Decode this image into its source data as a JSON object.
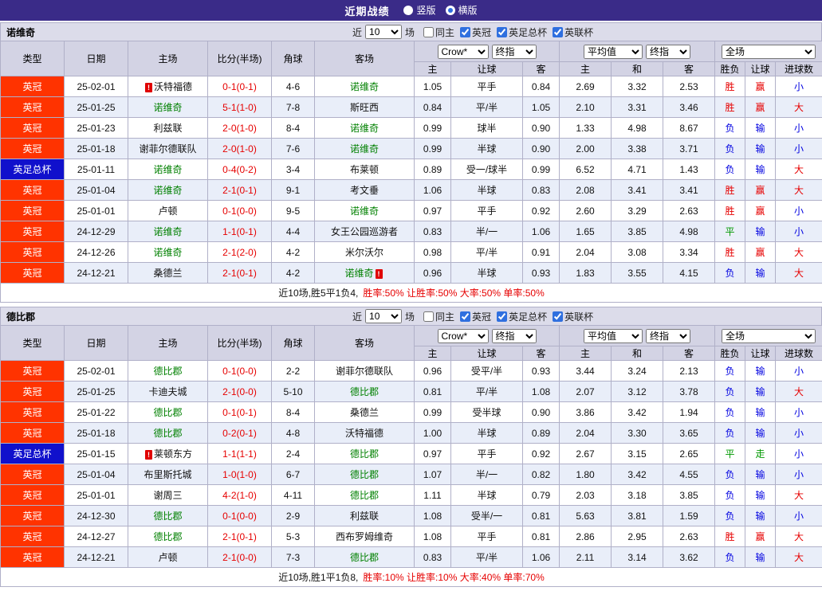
{
  "topbar": {
    "title": "近期战绩",
    "options": [
      {
        "label": "竖版",
        "selected": false
      },
      {
        "label": "横版",
        "selected": true
      }
    ]
  },
  "controls": {
    "near_label": "近",
    "match_count": "10",
    "unit_label": "场",
    "filters": [
      {
        "label": "同主",
        "checked": false
      },
      {
        "label": "英冠",
        "checked": true
      },
      {
        "label": "英足总杯",
        "checked": true
      },
      {
        "label": "英联杯",
        "checked": true
      }
    ]
  },
  "table": {
    "headers": {
      "type": "类型",
      "date": "日期",
      "home": "主场",
      "score": "比分(半场)",
      "corners": "角球",
      "away": "客场",
      "odds_sub": [
        "主",
        "让球",
        "客"
      ],
      "avg_sub": [
        "主",
        "和",
        "客"
      ],
      "result_sub": [
        "胜负",
        "让球",
        "进球数"
      ]
    },
    "selects": {
      "company": "Crow*",
      "final_a": "终指",
      "average": "平均值",
      "final_b": "终指",
      "full": "全场"
    }
  },
  "colors": {
    "topbar_bg": "#3a2b88",
    "control_bg": "#dcdcea",
    "header_bg": "#d3d3e4",
    "border": "#b0b0c8",
    "alt_row_bg": "#e9eef9",
    "league_bg": "#ff3300",
    "cup_bg": "#1010cc",
    "featured_team": "#008000",
    "score": "#e60000",
    "result_win": "#e60000",
    "result_loss": "#0000e0",
    "result_draw": "#009900",
    "rate_text": "#e60000",
    "radio_dot": "#2f6fdf"
  },
  "result_color_map": {
    "胜": "win",
    "赢": "win",
    "大": "win",
    "负": "loss",
    "输": "loss",
    "小": "loss",
    "平": "draw",
    "走": "draw"
  },
  "sections": [
    {
      "team": "诺维奇",
      "summary_prefix": "近10场,胜5平1负4,",
      "summary_rates": "胜率:50% 让胜率:50% 大率:50% 单率:50%",
      "rows": [
        {
          "type": "英冠",
          "cup": false,
          "date": "25-02-01",
          "home": "沃特福德",
          "home_featured": false,
          "home_alert": "before",
          "score": "0-1(0-1)",
          "corners": "4-6",
          "away": "诺维奇",
          "away_featured": true,
          "away_alert": "none",
          "odds": [
            "1.05",
            "平手",
            "0.84"
          ],
          "avg": [
            "2.69",
            "3.32",
            "2.53"
          ],
          "results": [
            "胜",
            "赢",
            "小"
          ]
        },
        {
          "type": "英冠",
          "cup": false,
          "date": "25-01-25",
          "home": "诺维奇",
          "home_featured": true,
          "home_alert": "none",
          "score": "5-1(1-0)",
          "corners": "7-8",
          "away": "斯旺西",
          "away_featured": false,
          "away_alert": "none",
          "odds": [
            "0.84",
            "平/半",
            "1.05"
          ],
          "avg": [
            "2.10",
            "3.31",
            "3.46"
          ],
          "results": [
            "胜",
            "赢",
            "大"
          ]
        },
        {
          "type": "英冠",
          "cup": false,
          "date": "25-01-23",
          "home": "利兹联",
          "home_featured": false,
          "home_alert": "none",
          "score": "2-0(1-0)",
          "corners": "8-4",
          "away": "诺维奇",
          "away_featured": true,
          "away_alert": "none",
          "odds": [
            "0.99",
            "球半",
            "0.90"
          ],
          "avg": [
            "1.33",
            "4.98",
            "8.67"
          ],
          "results": [
            "负",
            "输",
            "小"
          ]
        },
        {
          "type": "英冠",
          "cup": false,
          "date": "25-01-18",
          "home": "谢菲尔德联队",
          "home_featured": false,
          "home_alert": "none",
          "score": "2-0(1-0)",
          "corners": "7-6",
          "away": "诺维奇",
          "away_featured": true,
          "away_alert": "none",
          "odds": [
            "0.99",
            "半球",
            "0.90"
          ],
          "avg": [
            "2.00",
            "3.38",
            "3.71"
          ],
          "results": [
            "负",
            "输",
            "小"
          ]
        },
        {
          "type": "英足总杯",
          "cup": true,
          "date": "25-01-11",
          "home": "诺维奇",
          "home_featured": true,
          "home_alert": "none",
          "score": "0-4(0-2)",
          "corners": "3-4",
          "away": "布莱顿",
          "away_featured": false,
          "away_alert": "none",
          "odds": [
            "0.89",
            "受一/球半",
            "0.99"
          ],
          "avg": [
            "6.52",
            "4.71",
            "1.43"
          ],
          "results": [
            "负",
            "输",
            "大"
          ]
        },
        {
          "type": "英冠",
          "cup": false,
          "date": "25-01-04",
          "home": "诺维奇",
          "home_featured": true,
          "home_alert": "none",
          "score": "2-1(0-1)",
          "corners": "9-1",
          "away": "考文垂",
          "away_featured": false,
          "away_alert": "none",
          "odds": [
            "1.06",
            "半球",
            "0.83"
          ],
          "avg": [
            "2.08",
            "3.41",
            "3.41"
          ],
          "results": [
            "胜",
            "赢",
            "大"
          ]
        },
        {
          "type": "英冠",
          "cup": false,
          "date": "25-01-01",
          "home": "卢顿",
          "home_featured": false,
          "home_alert": "none",
          "score": "0-1(0-0)",
          "corners": "9-5",
          "away": "诺维奇",
          "away_featured": true,
          "away_alert": "none",
          "odds": [
            "0.97",
            "平手",
            "0.92"
          ],
          "avg": [
            "2.60",
            "3.29",
            "2.63"
          ],
          "results": [
            "胜",
            "赢",
            "小"
          ]
        },
        {
          "type": "英冠",
          "cup": false,
          "date": "24-12-29",
          "home": "诺维奇",
          "home_featured": true,
          "home_alert": "none",
          "score": "1-1(0-1)",
          "corners": "4-4",
          "away": "女王公园巡游者",
          "away_featured": false,
          "away_alert": "none",
          "odds": [
            "0.83",
            "半/一",
            "1.06"
          ],
          "avg": [
            "1.65",
            "3.85",
            "4.98"
          ],
          "results": [
            "平",
            "输",
            "小"
          ]
        },
        {
          "type": "英冠",
          "cup": false,
          "date": "24-12-26",
          "home": "诺维奇",
          "home_featured": true,
          "home_alert": "none",
          "score": "2-1(2-0)",
          "corners": "4-2",
          "away": "米尔沃尔",
          "away_featured": false,
          "away_alert": "none",
          "odds": [
            "0.98",
            "平/半",
            "0.91"
          ],
          "avg": [
            "2.04",
            "3.08",
            "3.34"
          ],
          "results": [
            "胜",
            "赢",
            "大"
          ]
        },
        {
          "type": "英冠",
          "cup": false,
          "date": "24-12-21",
          "home": "桑德兰",
          "home_featured": false,
          "home_alert": "none",
          "score": "2-1(0-1)",
          "corners": "4-2",
          "away": "诺维奇",
          "away_featured": true,
          "away_alert": "after",
          "odds": [
            "0.96",
            "半球",
            "0.93"
          ],
          "avg": [
            "1.83",
            "3.55",
            "4.15"
          ],
          "results": [
            "负",
            "输",
            "大"
          ]
        }
      ]
    },
    {
      "team": "德比郡",
      "summary_prefix": "近10场,胜1平1负8,",
      "summary_rates": "胜率:10% 让胜率:10% 大率:40% 单率:70%",
      "rows": [
        {
          "type": "英冠",
          "cup": false,
          "date": "25-02-01",
          "home": "德比郡",
          "home_featured": true,
          "home_alert": "none",
          "score": "0-1(0-0)",
          "corners": "2-2",
          "away": "谢菲尔德联队",
          "away_featured": false,
          "away_alert": "none",
          "odds": [
            "0.96",
            "受平/半",
            "0.93"
          ],
          "avg": [
            "3.44",
            "3.24",
            "2.13"
          ],
          "results": [
            "负",
            "输",
            "小"
          ]
        },
        {
          "type": "英冠",
          "cup": false,
          "date": "25-01-25",
          "home": "卡迪夫城",
          "home_featured": false,
          "home_alert": "none",
          "score": "2-1(0-0)",
          "corners": "5-10",
          "away": "德比郡",
          "away_featured": true,
          "away_alert": "none",
          "odds": [
            "0.81",
            "平/半",
            "1.08"
          ],
          "avg": [
            "2.07",
            "3.12",
            "3.78"
          ],
          "results": [
            "负",
            "输",
            "大"
          ]
        },
        {
          "type": "英冠",
          "cup": false,
          "date": "25-01-22",
          "home": "德比郡",
          "home_featured": true,
          "home_alert": "none",
          "score": "0-1(0-1)",
          "corners": "8-4",
          "away": "桑德兰",
          "away_featured": false,
          "away_alert": "none",
          "odds": [
            "0.99",
            "受半球",
            "0.90"
          ],
          "avg": [
            "3.86",
            "3.42",
            "1.94"
          ],
          "results": [
            "负",
            "输",
            "小"
          ]
        },
        {
          "type": "英冠",
          "cup": false,
          "date": "25-01-18",
          "home": "德比郡",
          "home_featured": true,
          "home_alert": "none",
          "score": "0-2(0-1)",
          "corners": "4-8",
          "away": "沃特福德",
          "away_featured": false,
          "away_alert": "none",
          "odds": [
            "1.00",
            "半球",
            "0.89"
          ],
          "avg": [
            "2.04",
            "3.30",
            "3.65"
          ],
          "results": [
            "负",
            "输",
            "小"
          ]
        },
        {
          "type": "英足总杯",
          "cup": true,
          "date": "25-01-15",
          "home": "莱顿东方",
          "home_featured": false,
          "home_alert": "before",
          "score": "1-1(1-1)",
          "corners": "2-4",
          "away": "德比郡",
          "away_featured": true,
          "away_alert": "none",
          "odds": [
            "0.97",
            "平手",
            "0.92"
          ],
          "avg": [
            "2.67",
            "3.15",
            "2.65"
          ],
          "results": [
            "平",
            "走",
            "小"
          ]
        },
        {
          "type": "英冠",
          "cup": false,
          "date": "25-01-04",
          "home": "布里斯托城",
          "home_featured": false,
          "home_alert": "none",
          "score": "1-0(1-0)",
          "corners": "6-7",
          "away": "德比郡",
          "away_featured": true,
          "away_alert": "none",
          "odds": [
            "1.07",
            "半/一",
            "0.82"
          ],
          "avg": [
            "1.80",
            "3.42",
            "4.55"
          ],
          "results": [
            "负",
            "输",
            "小"
          ]
        },
        {
          "type": "英冠",
          "cup": false,
          "date": "25-01-01",
          "home": "谢周三",
          "home_featured": false,
          "home_alert": "none",
          "score": "4-2(1-0)",
          "corners": "4-11",
          "away": "德比郡",
          "away_featured": true,
          "away_alert": "none",
          "odds": [
            "1.11",
            "半球",
            "0.79"
          ],
          "avg": [
            "2.03",
            "3.18",
            "3.85"
          ],
          "results": [
            "负",
            "输",
            "大"
          ]
        },
        {
          "type": "英冠",
          "cup": false,
          "date": "24-12-30",
          "home": "德比郡",
          "home_featured": true,
          "home_alert": "none",
          "score": "0-1(0-0)",
          "corners": "2-9",
          "away": "利兹联",
          "away_featured": false,
          "away_alert": "none",
          "odds": [
            "1.08",
            "受半/一",
            "0.81"
          ],
          "avg": [
            "5.63",
            "3.81",
            "1.59"
          ],
          "results": [
            "负",
            "输",
            "小"
          ]
        },
        {
          "type": "英冠",
          "cup": false,
          "date": "24-12-27",
          "home": "德比郡",
          "home_featured": true,
          "home_alert": "none",
          "score": "2-1(0-1)",
          "corners": "5-3",
          "away": "西布罗姆维奇",
          "away_featured": false,
          "away_alert": "none",
          "odds": [
            "1.08",
            "平手",
            "0.81"
          ],
          "avg": [
            "2.86",
            "2.95",
            "2.63"
          ],
          "results": [
            "胜",
            "赢",
            "大"
          ]
        },
        {
          "type": "英冠",
          "cup": false,
          "date": "24-12-21",
          "home": "卢顿",
          "home_featured": false,
          "home_alert": "none",
          "score": "2-1(0-0)",
          "corners": "7-3",
          "away": "德比郡",
          "away_featured": true,
          "away_alert": "none",
          "odds": [
            "0.83",
            "平/半",
            "1.06"
          ],
          "avg": [
            "2.11",
            "3.14",
            "3.62"
          ],
          "results": [
            "负",
            "输",
            "大"
          ]
        }
      ]
    }
  ]
}
